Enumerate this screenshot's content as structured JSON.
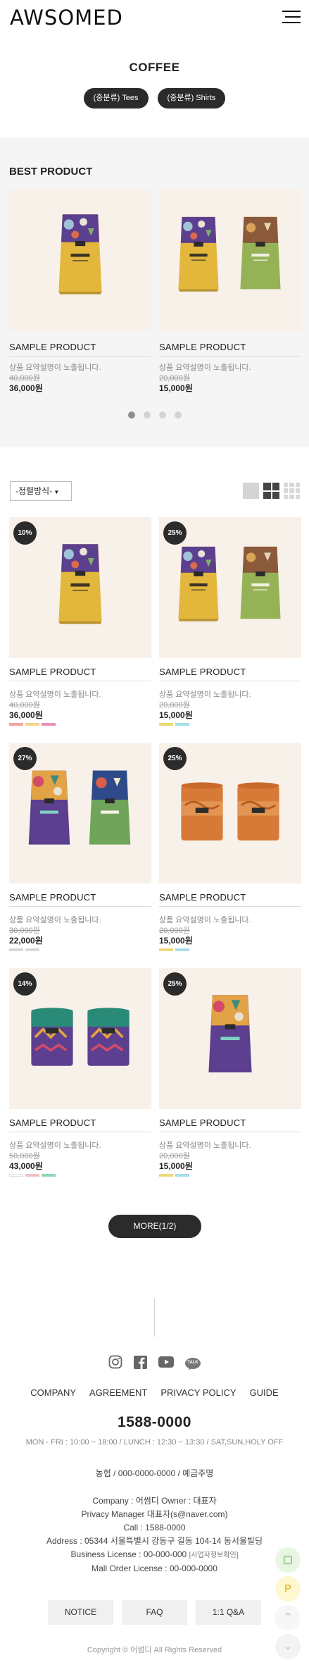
{
  "header": {
    "logo": "AWSOMED"
  },
  "category": {
    "title": "COFFEE",
    "subcategories": [
      "(중분류) Tees",
      "(중분류) Shirts"
    ]
  },
  "best": {
    "title": "BEST PRODUCT",
    "items": [
      {
        "name": "SAMPLE PRODUCT",
        "desc": "상품 요약설명이 노출됩니다.",
        "old_price": "40,000원",
        "price": "36,000원"
      },
      {
        "name": "SAMPLE PRODUCT",
        "desc": "상품 요약설명이 노출됩니다.",
        "old_price": "20,000원",
        "price": "15,000원"
      }
    ],
    "active_slide": 1,
    "slide_count": 4
  },
  "toolbar": {
    "sort_label": "-정렬방식-"
  },
  "products": [
    {
      "badge": "10%",
      "name": "SAMPLE PRODUCT",
      "desc": "상품 요약설명이 노출됩니다.",
      "old_price": "40,000원",
      "price": "36,000원",
      "swatches": [
        "#f3a49c",
        "#f6d38c",
        "#e98fb8"
      ]
    },
    {
      "badge": "25%",
      "name": "SAMPLE PRODUCT",
      "desc": "상품 요약설명이 노출됩니다.",
      "old_price": "20,000원",
      "price": "15,000원",
      "swatches": [
        "#efd877",
        "#a6dde8"
      ]
    },
    {
      "badge": "27%",
      "name": "SAMPLE PRODUCT",
      "desc": "상품 요약설명이 노출됩니다.",
      "old_price": "30,000원",
      "price": "22,000원",
      "swatches": [
        "#d8d8d8",
        "#d8d8d8"
      ]
    },
    {
      "badge": "25%",
      "name": "SAMPLE PRODUCT",
      "desc": "상품 요약설명이 노출됩니다.",
      "old_price": "20,000원",
      "price": "15,000원",
      "swatches": [
        "#efd877",
        "#a6dde8"
      ]
    },
    {
      "badge": "14%",
      "name": "SAMPLE PRODUCT",
      "desc": "상품 요약설명이 노출됩니다.",
      "old_price": "50,000원",
      "price": "43,000원",
      "swatches": [
        "#ffffff",
        "#f1c0c0",
        "#8fd8b5"
      ]
    },
    {
      "badge": "25%",
      "name": "SAMPLE PRODUCT",
      "desc": "상품 요약설명이 노출됩니다.",
      "old_price": "20,000원",
      "price": "15,000원",
      "swatches": [
        "#efd877",
        "#a6dde8"
      ]
    }
  ],
  "more_label": "MORE(1/2)",
  "footer": {
    "social": [
      "instagram-icon",
      "facebook-icon",
      "youtube-icon",
      "talk-icon"
    ],
    "talk_label": "TALK",
    "links": [
      "COMPANY",
      "AGREEMENT",
      "PRIVACY POLICY",
      "GUIDE"
    ],
    "phone": "1588-0000",
    "hours": "MON - FRI : 10:00 ~ 18:00 / LUNCH : 12:30 ~ 13:30 / SAT,SUN,HOLY OFF",
    "bank": "농협 / 000-0000-0000 / 예금주명",
    "company": "Company : 어썸디   Owner : 대표자",
    "privacy": "Privacy Manager  대표자(s@naver.com)",
    "call": "Call : 1588-0000",
    "address": "Address : 05344 서울특별시 강동구 길동 104-14 동서울빌딩",
    "business": "Business License : 00-000-000",
    "business_link": "[사업자정보확인]",
    "mall_order": "Mall Order License : 00-000-0000",
    "buttons": [
      "NOTICE",
      "FAQ",
      "1:1 Q&A"
    ],
    "copyright": "Copyright © 어썸디 All Rights Reserved"
  },
  "floating": {
    "talk_glyph": "▢",
    "pay_glyph": "P",
    "top_glyph": "⌃",
    "bottom_glyph": "⌄"
  },
  "colors": {
    "bag_yellow": "#e2b73c",
    "bag_green": "#96b256",
    "bag_purple": "#5c3f8e",
    "can_orange": "#d77a38",
    "can_teal": "#2a8a78",
    "dark": "#2b2b2b"
  }
}
